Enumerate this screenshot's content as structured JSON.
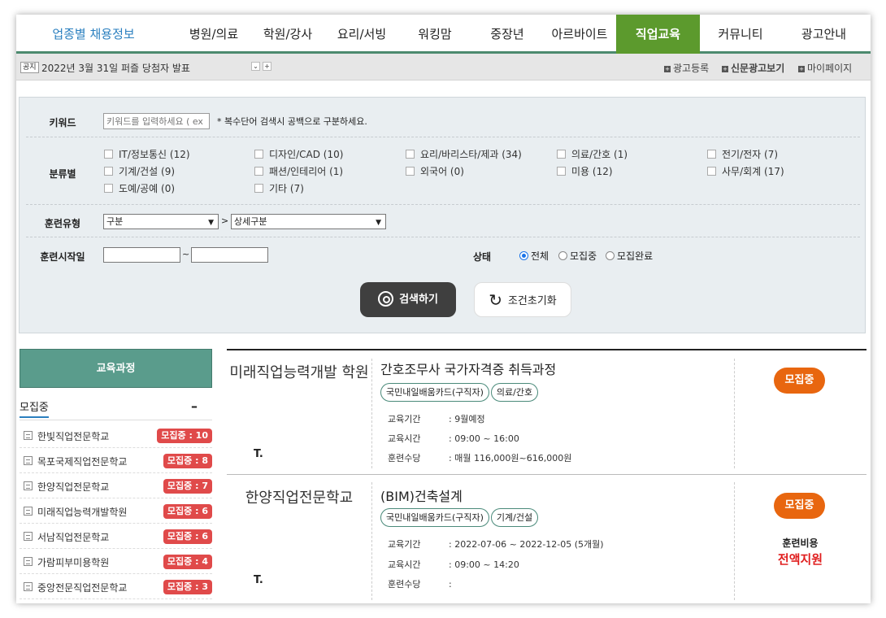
{
  "nav": {
    "brand": "업종별 채용정보",
    "items": [
      "병원/의료",
      "학원/강사",
      "요리/서빙",
      "워킹맘",
      "중장년",
      "아르바이트",
      "직업교육",
      "커뮤니티",
      "광고안내"
    ],
    "active_index": 6,
    "active_color": "#5c9a2d"
  },
  "notice": {
    "tag": "공지",
    "text": "2022년 3월 31일 퍼즐 당첨자 발표",
    "down_glyph": "⌄",
    "plus_glyph": "+",
    "links": [
      "광고등록",
      "신문광고보기",
      "마이페이지"
    ]
  },
  "search": {
    "keyword_label": "키워드",
    "keyword_placeholder": "키워드를 입력하세요 ( ex",
    "keyword_hint": "* 복수단어 검색시 공백으로 구분하세요.",
    "category_label": "분류별",
    "categories": [
      "IT/정보통신 (12)",
      "디자인/CAD (10)",
      "요리/바리스타/제과 (34)",
      "의료/간호 (1)",
      "전기/전자 (7)",
      "기계/건설 (9)",
      "패션/인테리어 (1)",
      "외국어 (0)",
      "미용 (12)",
      "사무/회계 (17)",
      "도예/공예 (0)",
      "기타 (7)"
    ],
    "training_type_label": "훈련유형",
    "type_select": "구분",
    "type_separator": ">",
    "detail_select": "상세구분",
    "start_date_label": "훈련시작일",
    "date_separator": "~",
    "status_label": "상태",
    "status_options": [
      "전체",
      "모집중",
      "모집완료"
    ],
    "status_selected": "전체",
    "search_button": "검색하기",
    "reset_button": "조건초기화",
    "reset_glyph": "↻"
  },
  "sidebar": {
    "title": "교육과정",
    "subtitle": "모집중",
    "collapse": "–",
    "items": [
      {
        "name": "한빛직업전문학교",
        "badge": "모집중 : 10"
      },
      {
        "name": "목포국제직업전문학교",
        "badge": "모집중 : 8"
      },
      {
        "name": "한양직업전문학교",
        "badge": "모집중 : 7"
      },
      {
        "name": "미래직업능력개발학원",
        "badge": "모집중 : 6"
      },
      {
        "name": "서남직업전문학교",
        "badge": "모집중 : 6"
      },
      {
        "name": "가람피부미용학원",
        "badge": "모집중 : 4"
      },
      {
        "name": "중앙전문직업전문학교",
        "badge": "모집중 : 3"
      }
    ]
  },
  "listings": [
    {
      "academy": "미래직업능력개발 학원",
      "phone": "T.",
      "title": "간호조무사 국가자격증 취득과정",
      "tags": [
        "국민내일배움카드(구직자)",
        "의료/간호"
      ],
      "info": [
        {
          "k": "교육기간",
          "v": ": 9월예정"
        },
        {
          "k": "교육시간",
          "v": ": 09:00 ~ 16:00"
        },
        {
          "k": "훈련수당",
          "v": ": 매월 116,000원~616,000원"
        }
      ],
      "status": "모집중",
      "fee_label": "",
      "fee_value": ""
    },
    {
      "academy": "한양직업전문학교",
      "phone": "T.",
      "title": "(BIM)건축설계",
      "tags": [
        "국민내일배움카드(구직자)",
        "기계/건설"
      ],
      "info": [
        {
          "k": "교육기간",
          "v": ": 2022-07-06 ~ 2022-12-05 (5개월)"
        },
        {
          "k": "교육시간",
          "v": ": 09:00 ~ 14:20"
        },
        {
          "k": "훈련수당",
          "v": ":"
        }
      ],
      "status": "모집중",
      "fee_label": "훈련비용",
      "fee_value": "전액지원"
    }
  ]
}
